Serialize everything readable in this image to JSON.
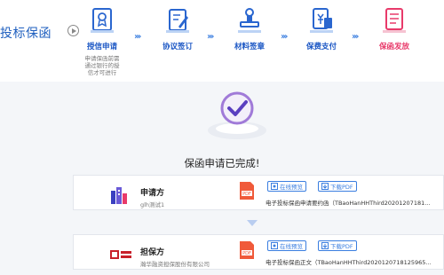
{
  "brand": {
    "title": "投标保函"
  },
  "steps": [
    {
      "label": "授信申请",
      "desc": [
        "申请保函前需",
        "通过银行的授",
        "信才可进行"
      ]
    },
    {
      "label": "协议签订"
    },
    {
      "label": "材料签章"
    },
    {
      "label": "保费支付"
    },
    {
      "label": "保函发放"
    }
  ],
  "status": {
    "text": "保函申请已完成!"
  },
  "applicant": {
    "role": "申请方",
    "org": "glh测试1",
    "preview": "在线预览",
    "download": "下载PDF",
    "file": "电子投标保函申请要约函（TBaoHanHHThird20201207181..."
  },
  "guarantor": {
    "role": "担保方",
    "org": "瀚华融资担保股份有限公司",
    "preview": "在线预览",
    "download": "下载PDF",
    "file": "电子投标保函正文（TBaoHanHHThird202012071812596​5..."
  },
  "colors": {
    "accent": "#1a56c4",
    "active": "#e83a6a",
    "bg": "#f4f6f9"
  }
}
